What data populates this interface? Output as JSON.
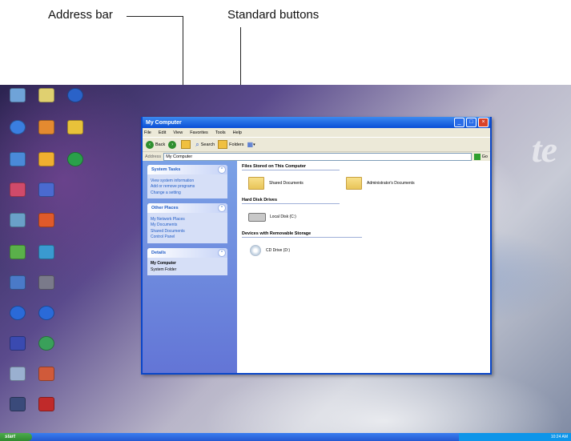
{
  "annotations": {
    "address_bar": "Address bar",
    "standard_buttons": "Standard buttons"
  },
  "window": {
    "title": "My Computer",
    "menu": [
      "File",
      "Edit",
      "View",
      "Favorites",
      "Tools",
      "Help"
    ],
    "toolbar": {
      "back": "Back",
      "search": "Search",
      "folders": "Folders"
    },
    "address": {
      "label": "Address",
      "value": "My Computer",
      "go": "Go"
    },
    "system_tasks": {
      "title": "System Tasks",
      "items": [
        "View system information",
        "Add or remove programs",
        "Change a setting"
      ]
    },
    "other_places": {
      "title": "Other Places",
      "items": [
        "My Network Places",
        "My Documents",
        "Shared Documents",
        "Control Panel"
      ]
    },
    "details": {
      "title": "Details",
      "name": "My Computer",
      "type": "System Folder"
    },
    "groups": {
      "files": {
        "title": "Files Stored on This Computer",
        "items": [
          "Shared Documents",
          "Administrator's Documents"
        ]
      },
      "hdd": {
        "title": "Hard Disk Drives",
        "items": [
          "Local Disk (C:)"
        ]
      },
      "removable": {
        "title": "Devices with Removable Storage",
        "items": [
          "CD Drive (D:)"
        ]
      }
    }
  },
  "taskbar": {
    "start": "start",
    "clock": "10:24 AM"
  }
}
